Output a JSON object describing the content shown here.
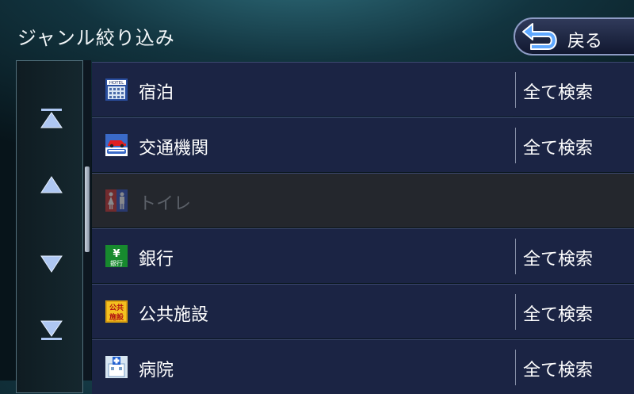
{
  "header": {
    "title": "ジャンル絞り込み",
    "back_label": "戻る"
  },
  "sidebar": {
    "buttons": [
      {
        "icon": "scroll-top-icon"
      },
      {
        "icon": "scroll-up-icon"
      },
      {
        "icon": "scroll-down-icon"
      },
      {
        "icon": "scroll-bottom-icon"
      }
    ]
  },
  "list": {
    "items": [
      {
        "label": "宿泊",
        "icon": "hotel-icon",
        "action": "全て検索",
        "enabled": true
      },
      {
        "label": "交通機関",
        "icon": "car-train-icon",
        "action": "全て検索",
        "enabled": true
      },
      {
        "label": "トイレ",
        "icon": "toilet-icon",
        "action": "",
        "enabled": false
      },
      {
        "label": "銀行",
        "icon": "bank-icon",
        "action": "全て検索",
        "enabled": true
      },
      {
        "label": "公共施設",
        "icon": "public-facility-icon",
        "action": "全て検索",
        "enabled": true
      },
      {
        "label": "病院",
        "icon": "hospital-icon",
        "action": "全て検索",
        "enabled": true
      }
    ]
  },
  "icon_text": {
    "hotel": "HOTEL",
    "bank_symbol": "¥",
    "bank_text": "銀行",
    "public_top": "公共",
    "public_bottom": "施設"
  },
  "colors": {
    "row_bg": "#1b2444",
    "row_disabled_bg": "#24272d",
    "accent": "#8d9bc4"
  }
}
